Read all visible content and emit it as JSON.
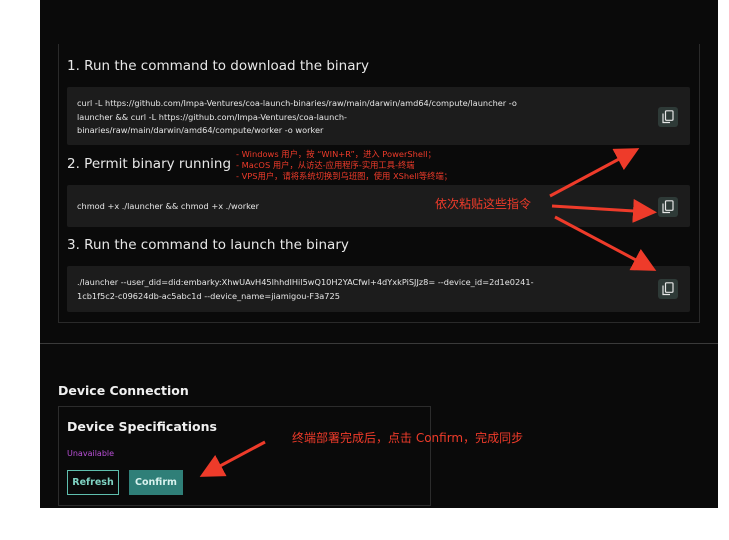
{
  "steps": [
    {
      "title": "1. Run the command to download the binary",
      "command_lines": [
        "curl -L https://github.com/Impa-Ventures/coa-launch-binaries/raw/main/darwin/amd64/compute/launcher -o",
        "launcher && curl -L https://github.com/Impa-Ventures/coa-launch-",
        "binaries/raw/main/darwin/amd64/compute/worker -o worker"
      ]
    },
    {
      "title": "2. Permit binary running",
      "command_lines": [
        "chmod +x ./launcher && chmod +x ./worker"
      ]
    },
    {
      "title": "3. Run the command to launch the binary",
      "command_lines": [
        "./launcher --user_did=did:embarky:XhwUAvH45lhhdIHil5wQ10H2YACfwl+4dYxkPiSJJz8= --device_id=2d1e0241-",
        "1cb1f5c2-c09624db-ac5abc1d --device_name=jiamigou-F3a725"
      ]
    }
  ],
  "device_connection": {
    "section_title": "Device Connection",
    "card_title": "Device Specifications",
    "status": "Unavailable",
    "refresh_label": "Refresh",
    "confirm_label": "Confirm"
  },
  "annotations": {
    "hints": [
      "- Windows 用户，按 “WIN+R”，进入 PowerShell；",
      "- MacOS 用户，从访达-应用程序-实用工具-终端",
      "- VPS用户，请将系统切换到乌班图，使用 XShell等终端；"
    ],
    "paste_note": "依次粘贴这些指令",
    "confirm_note": "终端部署完成后，点击 Confirm，完成同步",
    "color": "#ee3b2a"
  },
  "icons": {
    "copy": "copy-icon"
  }
}
